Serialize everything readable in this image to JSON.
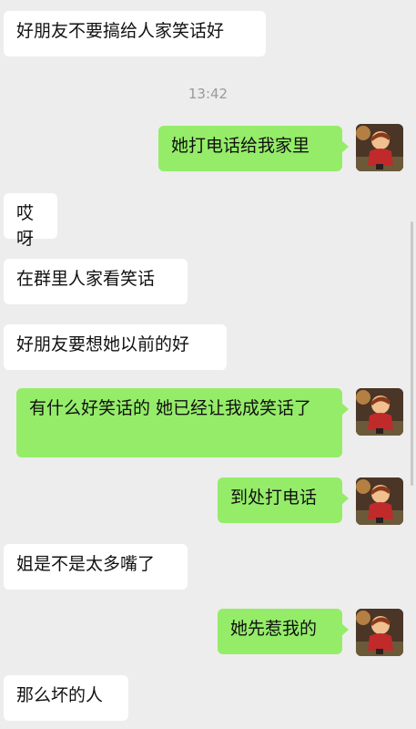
{
  "messages": {
    "m1": "好朋友不要搞给人家笑话好",
    "time": "13:42",
    "m2": "她打电话给我家里",
    "m3": "哎呀",
    "m4": "在群里人家看笑话",
    "m5": "好朋友要想她以前的好",
    "m6": "有什么好笑话的 她已经让我成笑话了",
    "m7": "到处打电话",
    "m8": "姐是不是太多嘴了",
    "m9": "她先惹我的",
    "m10": "那么坏的人"
  },
  "colors": {
    "background": "#ededed",
    "incoming_bubble": "#ffffff",
    "outgoing_bubble": "#95ec69"
  }
}
